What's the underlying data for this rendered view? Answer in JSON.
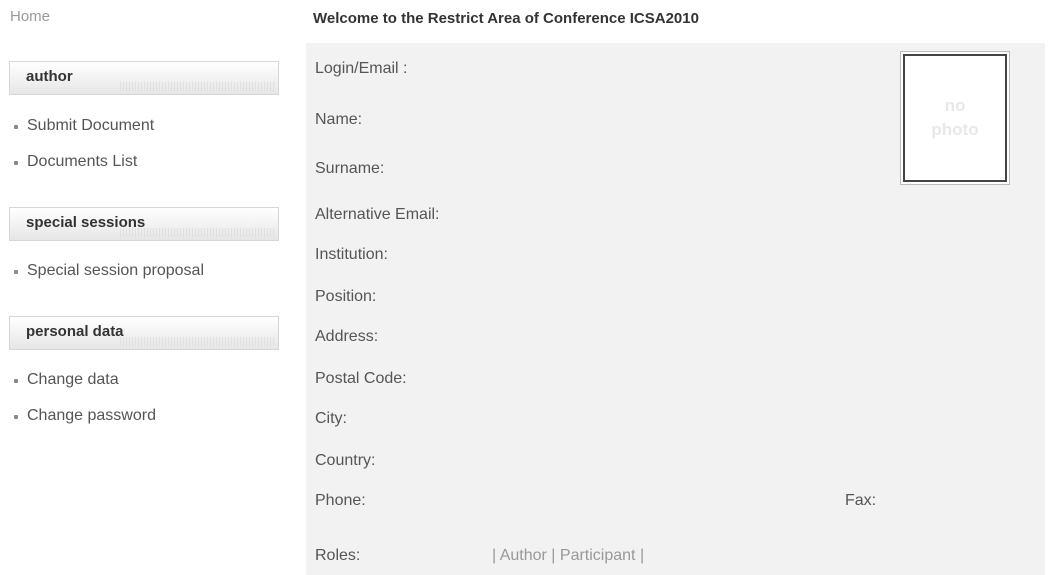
{
  "nav": {
    "home": "Home"
  },
  "sidebar": {
    "sections": [
      {
        "title": "author",
        "items": [
          "Submit Document",
          "Documents List"
        ]
      },
      {
        "title": "special sessions",
        "items": [
          "Special session proposal"
        ]
      },
      {
        "title": "personal data",
        "items": [
          "Change data",
          "Change password"
        ]
      }
    ]
  },
  "main": {
    "title": "Welcome to the Restrict Area of Conference ICSA2010",
    "labels": {
      "login": "Login/Email :",
      "name": "Name:",
      "surname": "Surname:",
      "alt_email": "Alternative Email:",
      "institution": "Institution:",
      "position": "Position:",
      "address": "Address:",
      "postal_code": "Postal Code:",
      "city": "City:",
      "country": "Country:",
      "phone": "Phone:",
      "fax": "Fax:",
      "roles": "Roles:"
    },
    "roles_value": "| Author | Participant |",
    "photo": {
      "line1": "no",
      "line2": "photo"
    }
  }
}
